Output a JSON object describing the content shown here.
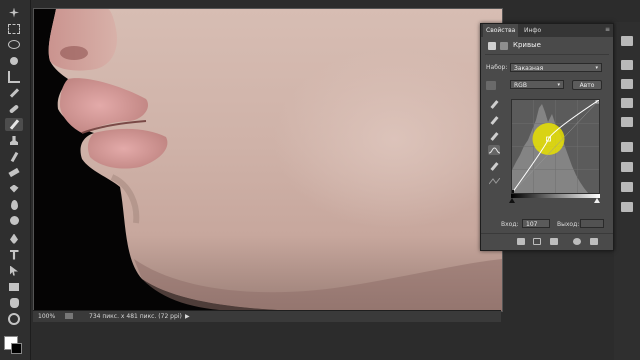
{
  "status": {
    "zoom": "100%",
    "doc_info": "734 пикс. x 481 пикс. (72 ppi)"
  },
  "panel": {
    "tabs": [
      {
        "label": "Свойства"
      },
      {
        "label": "Инфо"
      }
    ],
    "title": "Кривые",
    "preset_label": "Набор:",
    "preset_value": "Заказная",
    "channel_value": "RGB",
    "auto_label": "Авто",
    "input_label": "Вход:",
    "input_value": "107",
    "output_label": "Выход:",
    "output_value": ""
  },
  "curve": {
    "control_point": {
      "input": 107,
      "output": 148
    },
    "highlight_color": "#e8e000"
  }
}
